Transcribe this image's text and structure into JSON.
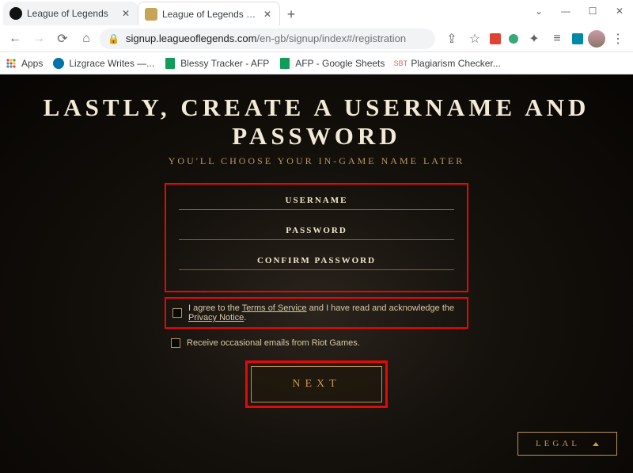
{
  "tabs": {
    "inactive": {
      "title": "League of Legends"
    },
    "active": {
      "title": "League of Legends Sign Up | EU…"
    }
  },
  "toolbar": {
    "url_host": "signup.leagueoflegends.com",
    "url_path": "/en-gb/signup/index#/registration"
  },
  "bookmarks": [
    {
      "label": "Apps"
    },
    {
      "label": "Lizgrace Writes —..."
    },
    {
      "label": "Blessy Tracker - AFP"
    },
    {
      "label": "AFP - Google Sheets"
    },
    {
      "label": "Plagiarism Checker..."
    }
  ],
  "page": {
    "heading": "LASTLY, CREATE A USERNAME AND PASSWORD",
    "subtitle": "YOU'LL CHOOSE YOUR IN-GAME NAME LATER",
    "fields": {
      "username": "USERNAME",
      "password": "PASSWORD",
      "confirm": "CONFIRM PASSWORD"
    },
    "tos": {
      "prefix": "I agree to the ",
      "tos_link": "Terms of Service",
      "middle": " and I have read and acknowledge the ",
      "privacy_link": "Privacy Notice",
      "suffix": "."
    },
    "emails_label": "Receive occasional emails from Riot Games.",
    "next_label": "NEXT",
    "legal_label": "LEGAL"
  }
}
